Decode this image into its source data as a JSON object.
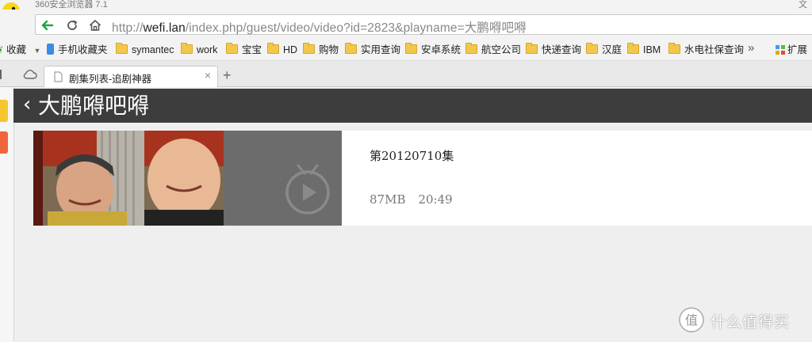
{
  "browser": {
    "window_title": "360安全浏览器 7.1",
    "window_title_right": "文",
    "url_host": "wefi.lan",
    "url_prefix": "http://",
    "url_path": "/index.php/guest/video/video?id=2823&playname=大鹏嘚吧嘚"
  },
  "bookmarks": {
    "favorites_label": "收藏",
    "items": [
      {
        "label": "手机收藏夹",
        "icon": "phone-icon"
      },
      {
        "label": "symantec",
        "icon": "folder-icon"
      },
      {
        "label": "work",
        "icon": "folder-icon"
      },
      {
        "label": "宝宝",
        "icon": "folder-icon"
      },
      {
        "label": "HD",
        "icon": "folder-icon"
      },
      {
        "label": "购物",
        "icon": "folder-icon"
      },
      {
        "label": "实用查询",
        "icon": "folder-icon"
      },
      {
        "label": "安卓系统",
        "icon": "folder-icon"
      },
      {
        "label": "航空公司",
        "icon": "folder-icon"
      },
      {
        "label": "快递查询",
        "icon": "folder-icon"
      },
      {
        "label": "汉庭",
        "icon": "folder-icon"
      },
      {
        "label": "IBM",
        "icon": "folder-icon"
      },
      {
        "label": "水电社保查询",
        "icon": "folder-icon"
      }
    ],
    "more_label": "»",
    "extensions_label": "扩展"
  },
  "tabs": {
    "active_tab_label": "剧集列表-追剧神器",
    "close_label": "×",
    "new_tab_label": "+"
  },
  "page": {
    "back_label": "‹",
    "title": "大鹏嘚吧嘚",
    "episode": {
      "title": "第20120710集",
      "size": "87MB",
      "duration": "20:49"
    }
  },
  "watermark": {
    "text": "什么值得买",
    "badge": "值"
  },
  "colors": {
    "header_bg": "#3d3d3d",
    "play_panel_bg": "#6c6c6c",
    "back_arrow_green": "#27a343"
  }
}
